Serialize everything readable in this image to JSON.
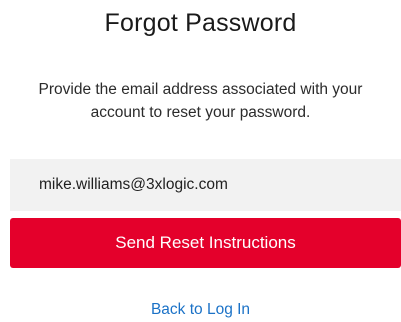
{
  "title": "Forgot Password",
  "instructions": {
    "line1": "Provide the email address associated with your",
    "line2": "account to reset your password."
  },
  "email_field": {
    "value": "mike.williams@3xlogic.com"
  },
  "send_button_label": "Send Reset Instructions",
  "back_link_label": "Back to Log In",
  "colors": {
    "primary_button": "#e4002b",
    "link": "#1b72c7",
    "input_background": "#f2f2f2"
  }
}
